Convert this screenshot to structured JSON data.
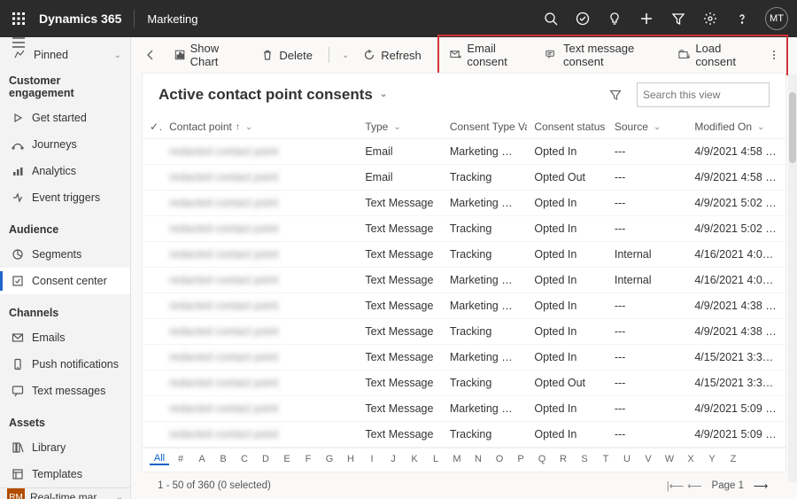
{
  "header": {
    "brand": "Dynamics 365",
    "module": "Marketing",
    "avatar": "MT"
  },
  "sidebar": {
    "pinned": "Pinned",
    "sections": [
      {
        "title": "Customer engagement",
        "items": [
          {
            "icon": "play-icon",
            "label": "Get started"
          },
          {
            "icon": "journeys-icon",
            "label": "Journeys"
          },
          {
            "icon": "analytics-icon",
            "label": "Analytics"
          },
          {
            "icon": "trigger-icon",
            "label": "Event triggers"
          }
        ]
      },
      {
        "title": "Audience",
        "items": [
          {
            "icon": "segments-icon",
            "label": "Segments"
          },
          {
            "icon": "consent-icon",
            "label": "Consent center",
            "active": true
          }
        ]
      },
      {
        "title": "Channels",
        "items": [
          {
            "icon": "email-icon",
            "label": "Emails"
          },
          {
            "icon": "push-icon",
            "label": "Push notifications"
          },
          {
            "icon": "sms-icon",
            "label": "Text messages"
          }
        ]
      },
      {
        "title": "Assets",
        "items": [
          {
            "icon": "library-icon",
            "label": "Library"
          },
          {
            "icon": "templates-icon",
            "label": "Templates"
          }
        ]
      }
    ],
    "footer": {
      "badge": "RM",
      "label": "Real-time marketi…"
    }
  },
  "commandbar": {
    "show_chart": "Show Chart",
    "delete": "Delete",
    "refresh": "Refresh",
    "email_consent": "Email consent",
    "text_consent": "Text message consent",
    "load_consent": "Load consent"
  },
  "view": {
    "title": "Active contact point consents",
    "search_placeholder": "Search this view"
  },
  "grid": {
    "columns": [
      {
        "label": "Contact point",
        "sort": "asc"
      },
      {
        "label": "Type"
      },
      {
        "label": "Consent Type Va…"
      },
      {
        "label": "Consent status"
      },
      {
        "label": "Source"
      },
      {
        "label": "Modified On"
      }
    ],
    "rows": [
      {
        "type": "Email",
        "ctv": "Marketing Co…",
        "status": "Opted In",
        "source": "---",
        "modified": "4/9/2021 4:58 …"
      },
      {
        "type": "Email",
        "ctv": "Tracking",
        "status": "Opted Out",
        "source": "---",
        "modified": "4/9/2021 4:58 …"
      },
      {
        "type": "Text Message",
        "ctv": "Marketing Co…",
        "status": "Opted In",
        "source": "---",
        "modified": "4/9/2021 5:02 …"
      },
      {
        "type": "Text Message",
        "ctv": "Tracking",
        "status": "Opted In",
        "source": "---",
        "modified": "4/9/2021 5:02 …"
      },
      {
        "type": "Text Message",
        "ctv": "Tracking",
        "status": "Opted In",
        "source": "Internal",
        "modified": "4/16/2021 4:0…"
      },
      {
        "type": "Text Message",
        "ctv": "Marketing Co…",
        "status": "Opted In",
        "source": "Internal",
        "modified": "4/16/2021 4:0…"
      },
      {
        "type": "Text Message",
        "ctv": "Marketing Co…",
        "status": "Opted In",
        "source": "---",
        "modified": "4/9/2021 4:38 …"
      },
      {
        "type": "Text Message",
        "ctv": "Tracking",
        "status": "Opted In",
        "source": "---",
        "modified": "4/9/2021 4:38 …"
      },
      {
        "type": "Text Message",
        "ctv": "Marketing Co…",
        "status": "Opted In",
        "source": "---",
        "modified": "4/15/2021 3:3…"
      },
      {
        "type": "Text Message",
        "ctv": "Tracking",
        "status": "Opted Out",
        "source": "---",
        "modified": "4/15/2021 3:3…"
      },
      {
        "type": "Text Message",
        "ctv": "Marketing Co…",
        "status": "Opted In",
        "source": "---",
        "modified": "4/9/2021 5:09 …"
      },
      {
        "type": "Text Message",
        "ctv": "Tracking",
        "status": "Opted In",
        "source": "---",
        "modified": "4/9/2021 5:09 …"
      }
    ],
    "alpha": [
      "All",
      "#",
      "A",
      "B",
      "C",
      "D",
      "E",
      "F",
      "G",
      "H",
      "I",
      "J",
      "K",
      "L",
      "M",
      "N",
      "O",
      "P",
      "Q",
      "R",
      "S",
      "T",
      "U",
      "V",
      "W",
      "X",
      "Y",
      "Z"
    ]
  },
  "footer": {
    "status": "1 - 50 of 360 (0 selected)",
    "page": "Page 1"
  }
}
